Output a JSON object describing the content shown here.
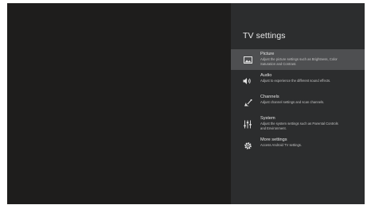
{
  "panel": {
    "title": "TV settings"
  },
  "menu": {
    "items": [
      {
        "icon": "picture-icon",
        "title": "Picture",
        "description_line1": "Adjust the picture settings such as Brightness, Color",
        "description_line2": "Saturation and Contrast.",
        "selected": true
      },
      {
        "icon": "speaker-icon",
        "title": "Audio",
        "description_line1": "Adjust to experience the different sound effects.",
        "description_line2": "",
        "selected": false
      },
      {
        "icon": "satellite-dish-icon",
        "title": "Channels",
        "description_line1": "Adjust channel settings and scan channels.",
        "description_line2": "",
        "selected": false
      },
      {
        "icon": "sliders-icon",
        "title": "System",
        "description_line1": "Adjust the system settings such as Parental Controls",
        "description_line2": "and Environment.",
        "selected": false
      },
      {
        "icon": "gear-icon",
        "title": "More settings",
        "description_line1": "Access Android TV settings.",
        "description_line2": "",
        "selected": false
      }
    ]
  },
  "colors": {
    "screen_background": "#1e1d1c",
    "panel_background": "#2c2d2e",
    "selected_background": "#4e4f51",
    "text_primary": "#e6e6e6",
    "text_secondary": "#c2c2c2"
  }
}
